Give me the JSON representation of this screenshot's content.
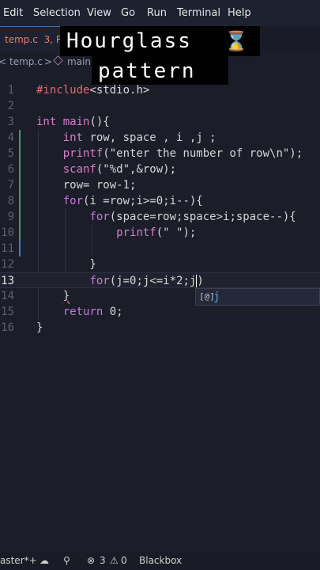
{
  "menu": [
    "Edit",
    "Selection",
    "View",
    "Go",
    "Run",
    "Terminal",
    "Help"
  ],
  "tab": {
    "filename": "temp.c",
    "badge": "3, R"
  },
  "breadcrumb": {
    "file": "temp.c",
    "symbol": "main"
  },
  "overlay": {
    "line1": "Hourglass",
    "line2": "pattern",
    "emoji": "⌛"
  },
  "editor": {
    "line_numbers": [
      "1",
      "2",
      "3",
      "4",
      "5",
      "6",
      "7",
      "8",
      "9",
      "10",
      "11",
      "12",
      "13",
      "14",
      "15",
      "16"
    ],
    "current_line": "13"
  },
  "suggestion": {
    "label": "j"
  },
  "status": {
    "branch": "aster*+",
    "errors": "3",
    "warnings": "0",
    "extension": "Blackbox"
  }
}
